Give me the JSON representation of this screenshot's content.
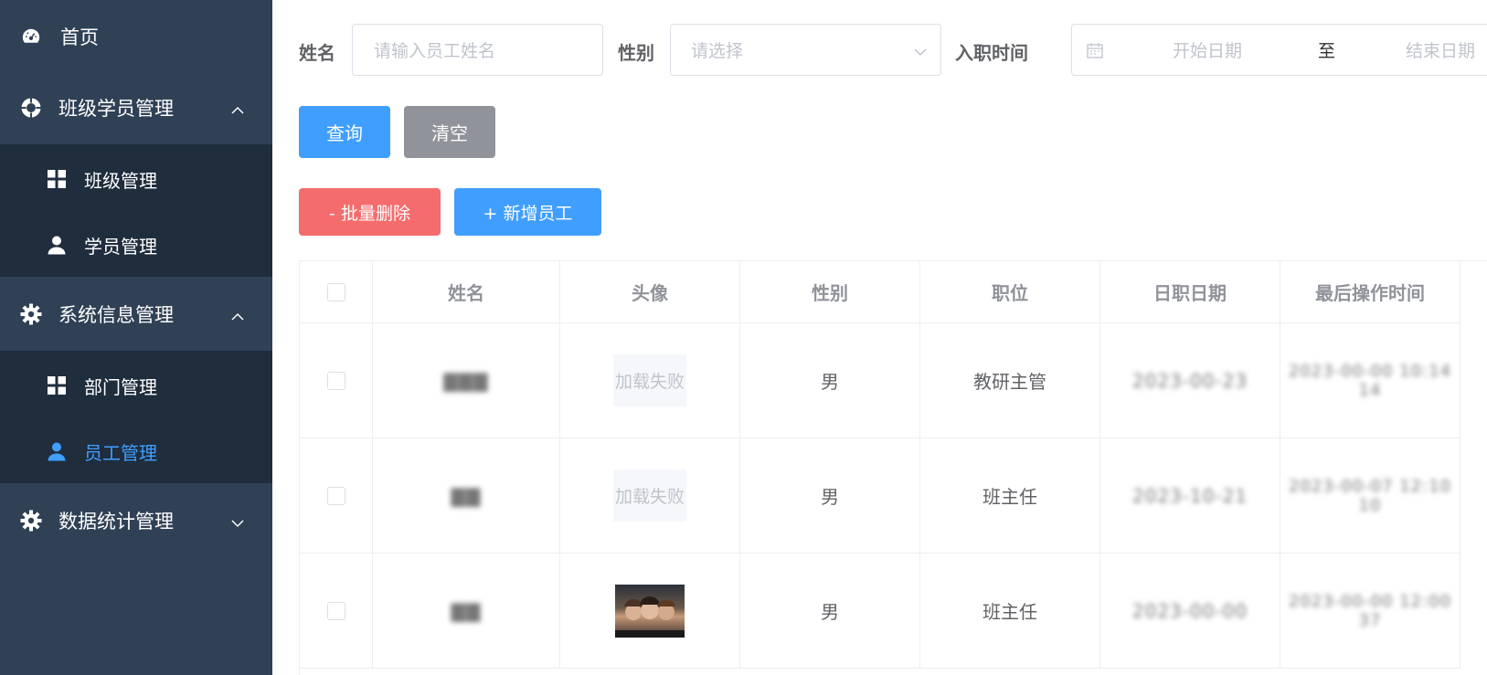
{
  "sidebar": {
    "home": "首页",
    "class_student_mgmt": "班级学员管理",
    "class_mgmt": "班级管理",
    "student_mgmt": "学员管理",
    "system_info_mgmt": "系统信息管理",
    "dept_mgmt": "部门管理",
    "employee_mgmt": "员工管理",
    "data_stats_mgmt": "数据统计管理"
  },
  "search": {
    "name_label": "姓名",
    "name_placeholder": "请输入员工姓名",
    "gender_label": "性别",
    "gender_placeholder": "请选择",
    "hire_label": "入职时间",
    "start_placeholder": "开始日期",
    "range_sep": "至",
    "end_placeholder": "结束日期"
  },
  "buttons": {
    "query": "查询",
    "clear": "清空",
    "batch_delete": "- 批量删除",
    "add_employee": "+ 新增员工"
  },
  "table": {
    "headers": [
      "姓名",
      "头像",
      "性别",
      "职位",
      "日职日期",
      "最后操作时间"
    ],
    "rows": [
      {
        "name": "▇▇▇",
        "avatar": "加载失败",
        "gender": "男",
        "position": "教研主管",
        "hire": "2023-00-23",
        "updated": "2023-00-00 10:14",
        "updated2": "14"
      },
      {
        "name": "▇▇",
        "avatar": "加载失败",
        "gender": "男",
        "position": "班主任",
        "hire": "2023-10-21",
        "updated": "2023-00-07 12:10",
        "updated2": "10"
      },
      {
        "name": "▇▇",
        "avatar": "",
        "gender": "男",
        "position": "班主任",
        "hire": "2023-00-00",
        "updated": "2023-00-00 12:00",
        "updated2": "37"
      }
    ]
  },
  "colors": {
    "sidebar_bg": "#304156",
    "submenu_bg": "#1f2d3d",
    "primary": "#409eff",
    "danger": "#f56c6c",
    "info": "#909399"
  }
}
